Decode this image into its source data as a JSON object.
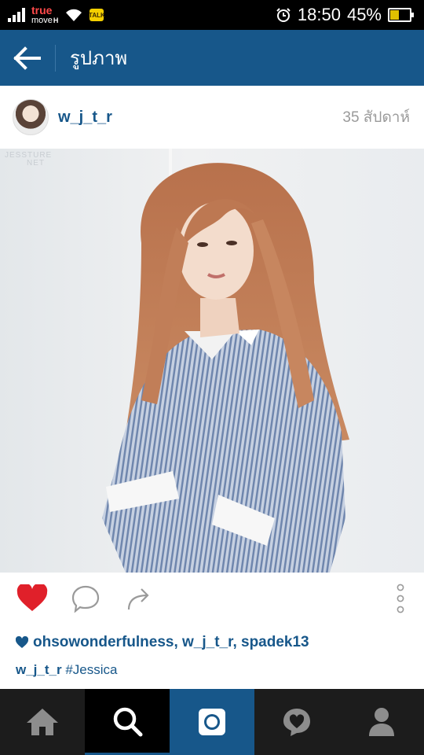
{
  "status_bar": {
    "carrier_top": "true",
    "carrier_bottom": "move",
    "carrier_badge": "H",
    "talk_badge": "TALK",
    "time": "18:50",
    "battery_percent": "45%",
    "battery_level": 0.45
  },
  "app_bar": {
    "back_icon": "arrow-left-icon",
    "title": "รูปภาพ"
  },
  "post": {
    "username": "w_j_t_r",
    "time_ago": "35 สัปดาห์",
    "watermark_line1": "JESSTURE",
    "watermark_line2": "NET",
    "liked": true,
    "likes_text": "ohsowonderfulness, w_j_t_r, spadek13",
    "caption_user": "w_j_t_r",
    "caption_text": "#Jessica"
  },
  "bottom_nav": {
    "items": [
      "home-icon",
      "search-icon",
      "camera-icon",
      "activity-heart-icon",
      "profile-icon"
    ],
    "active": "search-icon"
  },
  "colors": {
    "brand_blue": "#17578a",
    "like_red": "#e0202a",
    "nav_bg": "#1c1c1c"
  }
}
